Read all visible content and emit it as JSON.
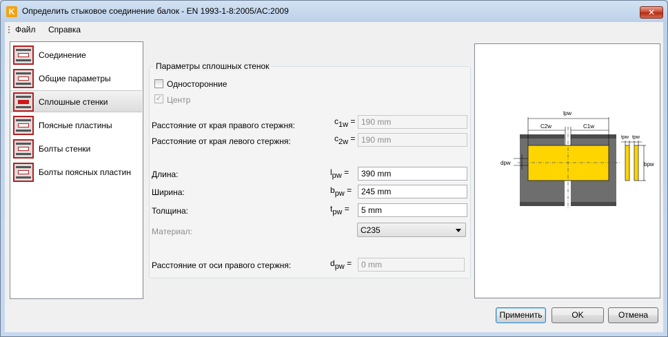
{
  "window": {
    "title": "Определить стыковое соединение балок - EN 1993-1-8:2005/AC:2009",
    "app_icon": "K",
    "close": "✕"
  },
  "menu": {
    "items": [
      "Файл",
      "Справка"
    ]
  },
  "sidebar": {
    "items": [
      {
        "label": "Соединение"
      },
      {
        "label": "Общие параметры"
      },
      {
        "label": "Сплошные стенки"
      },
      {
        "label": "Поясные пластины"
      },
      {
        "label": "Болты стенки"
      },
      {
        "label": "Болты поясных пластин"
      }
    ],
    "selected_index": 2
  },
  "group": {
    "title": "Параметры сплошных стенок",
    "one_sided": {
      "label": "Односторонние",
      "checked": false
    },
    "center": {
      "label": "Центр",
      "checked": true,
      "disabled": true
    },
    "rows": {
      "c1w": {
        "label": "Расстояние от края правого стержня:",
        "sym": "c",
        "sub": "1w",
        "eq": " =",
        "value": "190 mm"
      },
      "c2w": {
        "label": "Расстояние от края левого стержня:",
        "sym": "c",
        "sub": "2w",
        "eq": " =",
        "value": "190 mm"
      },
      "lpw": {
        "label": "Длина:",
        "sym": "l",
        "sub": "pw",
        "eq": " =",
        "value": "390 mm"
      },
      "bpw": {
        "label": "Ширина:",
        "sym": "b",
        "sub": "pw",
        "eq": " =",
        "value": "245 mm"
      },
      "tpw": {
        "label": "Толщина:",
        "sym": "t",
        "sub": "pw",
        "eq": " =",
        "value": "5 mm"
      },
      "material": {
        "label": "Материал:",
        "value": "C235"
      },
      "dpw": {
        "label": "Расстояние от оси правого стержня:",
        "sym": "d",
        "sub": "pw",
        "eq": " =",
        "value": "0 mm"
      }
    }
  },
  "diagram": {
    "labels": {
      "lpw": "lpw",
      "c2w": "C2w",
      "c1w": "C1w",
      "dpw": "dpw",
      "tpw1": "tpw",
      "tpw2": "tpw",
      "bpw": "bpw"
    },
    "colors": {
      "plate": "#ffd500",
      "beam": "#6e6e6e",
      "beam_dark": "#4a4a4a"
    }
  },
  "buttons": {
    "apply": "Применить",
    "ok": "OK",
    "cancel": "Отмена"
  }
}
